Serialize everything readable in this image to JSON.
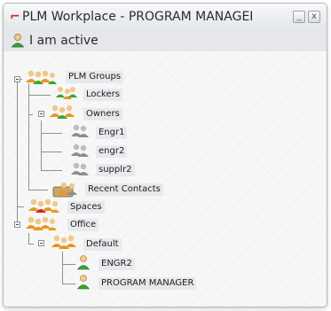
{
  "window": {
    "title": "PLM Workplace - PROGRAM MANAGEI",
    "minimize": "_",
    "close": "x"
  },
  "status": {
    "text": "I am active"
  },
  "tree": {
    "plm_groups": "PLM Groups",
    "lockers": "Lockers",
    "owners": "Owners",
    "engr1": "Engr1",
    "engr2": "engr2",
    "supplr2": "supplr2",
    "recent_contacts": "Recent Contacts",
    "spaces": "Spaces",
    "office": "Office",
    "default": "Default",
    "engr2_user": "ENGR2",
    "program_manager": "PROGRAM MANAGER"
  },
  "colors": {
    "active_green": "#3aa335",
    "group_orange": "#e8961e",
    "offline_grey": "#8e8e8e",
    "logo_red": "#d4251c"
  }
}
